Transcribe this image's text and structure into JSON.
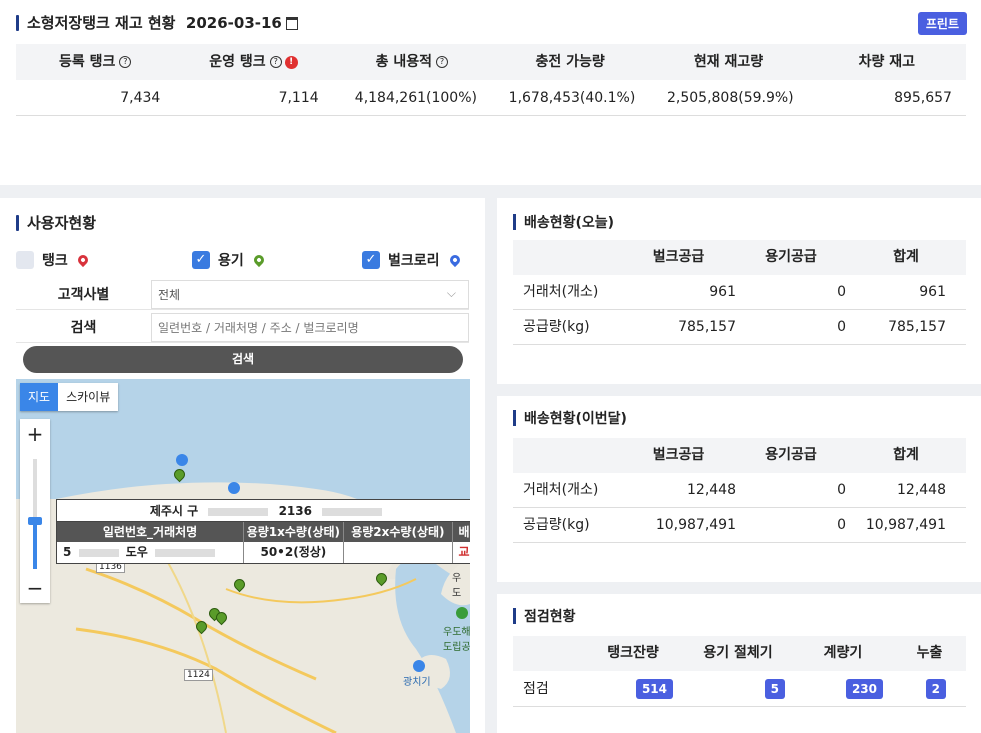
{
  "summary": {
    "title": "소형저장탱크 재고 현황",
    "date": "2026-03-16",
    "print_label": "프린트",
    "headers": [
      "등록 탱크",
      "운영 탱크",
      "총 내용적",
      "충전 가능량",
      "현재 재고량",
      "차량 재고"
    ],
    "values": [
      "7,434",
      "7,114",
      "4,184,261(100%)",
      "1,678,453(40.1%)",
      "2,505,808(59.9%)",
      "895,657"
    ]
  },
  "users": {
    "title": "사용자현황",
    "filters": [
      {
        "label": "탱크",
        "checked": false,
        "color": "#d8323c"
      },
      {
        "label": "용기",
        "checked": true,
        "color": "#5a9c2a"
      },
      {
        "label": "벌크로리",
        "checked": true,
        "color": "#3a6be0"
      }
    ],
    "customer_label": "고객사별",
    "customer_value": "전체",
    "search_label": "검색",
    "search_placeholder": "일련번호 / 거래처명 / 주소 / 벌크로리명",
    "search_button": "검색"
  },
  "map": {
    "type_map": "지도",
    "type_sky": "스카이뷰",
    "zoom_in": "+",
    "zoom_out": "−",
    "popup": {
      "header": "제주시 구",
      "header_num": "2136",
      "col1": "일련번호_거래처명",
      "col2": "용량1x수량(상태)",
      "col3": "용량2x수량(상태)",
      "col4": "배",
      "row_prefix": "5",
      "row_name": "도우",
      "row_cap1": "50•2(정상)",
      "row_cap2": "",
      "row_last": "교"
    },
    "labels": {
      "road1136": "1136",
      "road1124": "1124",
      "udo": "우도",
      "udo2": "우도해\n도립공",
      "gwangchigi": "광치기"
    }
  },
  "today": {
    "title": "배송현황(오늘)",
    "headers": [
      "",
      "벌크공급",
      "용기공급",
      "합계"
    ],
    "rows": [
      [
        "거래처(개소)",
        "961",
        "0",
        "961"
      ],
      [
        "공급량(kg)",
        "785,157",
        "0",
        "785,157"
      ]
    ]
  },
  "month": {
    "title": "배송현황(이번달)",
    "headers": [
      "",
      "벌크공급",
      "용기공급",
      "합계"
    ],
    "rows": [
      [
        "거래처(개소)",
        "12,448",
        "0",
        "12,448"
      ],
      [
        "공급량(kg)",
        "10,987,491",
        "0",
        "10,987,491"
      ]
    ]
  },
  "inspect": {
    "title": "점검현황",
    "headers": [
      "",
      "탱크잔량",
      "용기 절체기",
      "계량기",
      "누출"
    ],
    "row_label": "점검",
    "values": [
      "514",
      "5",
      "230",
      "2"
    ]
  }
}
